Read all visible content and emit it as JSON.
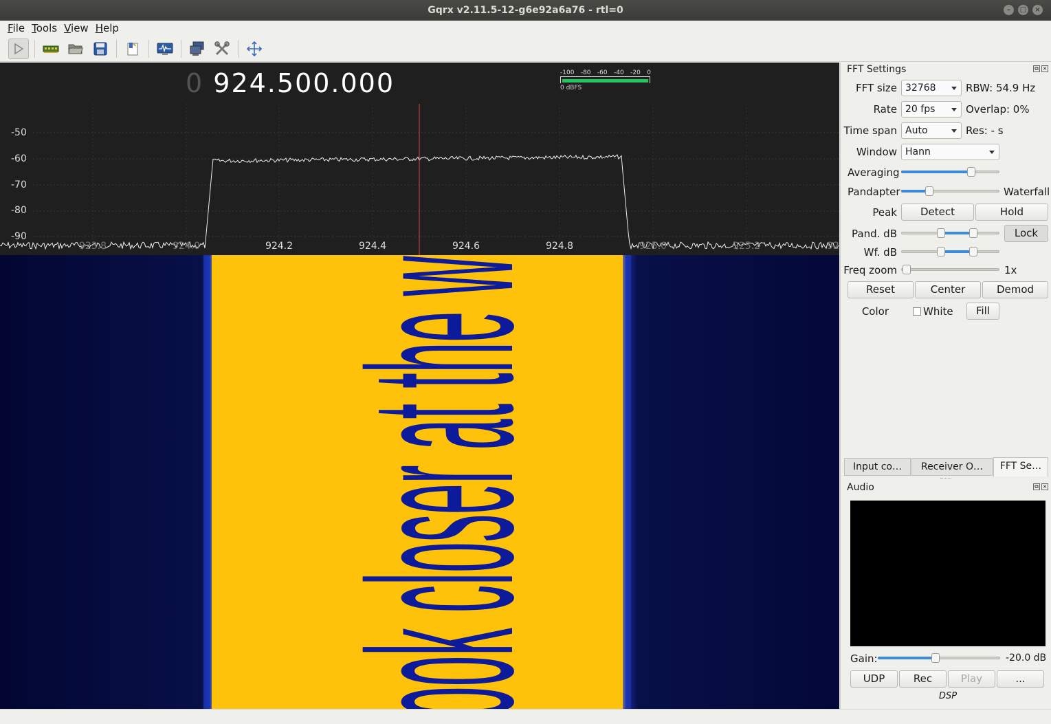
{
  "window": {
    "title": "Gqrx v2.11.5-12-g6e92a6a76 - rtl=0"
  },
  "menu": [
    {
      "underline": "F",
      "rest": "ile"
    },
    {
      "underline": "T",
      "rest": "ools"
    },
    {
      "underline": "V",
      "rest": "iew"
    },
    {
      "underline": "H",
      "rest": "elp"
    }
  ],
  "toolbar": {
    "icons": [
      "play-icon",
      "device-icon",
      "open-icon",
      "save-icon",
      "remote-icon",
      "waterfall-icon",
      "io-devices-icon",
      "config-icon",
      "fullscreen-icon"
    ]
  },
  "freq": {
    "prefix": "0",
    "value": "924.500.000"
  },
  "meter": {
    "ticks": [
      "-100",
      "-80",
      "-60",
      "-40",
      "-20",
      "0"
    ],
    "label": "0 dBFS",
    "color": "#22c55e"
  },
  "plot": {
    "y_labels": [
      "-50",
      "-60",
      "-70",
      "-80",
      "-90"
    ],
    "x_labels": [
      "923.8",
      "924.0",
      "924.2",
      "924.4",
      "924.6",
      "924.8",
      "925.0",
      "925.2",
      "92"
    ],
    "center_marker_color": "#e04545",
    "waterfall_text": "look closer at the waterfall"
  },
  "fft_settings": {
    "title": "FFT Settings",
    "fft_size_label": "FFT size",
    "fft_size": "32768",
    "rbw": "RBW: 54.9 Hz",
    "rate_label": "Rate",
    "rate": "20 fps",
    "overlap": "Overlap: 0%",
    "timespan_label": "Time span",
    "timespan": "Auto",
    "res": "Res: - s",
    "window_label": "Window",
    "window": "Hann",
    "averaging_label": "Averaging",
    "averaging_level": 0.73,
    "pandapter_label": "Pandapter",
    "waterfall_label": "Waterfall",
    "pandapter_split": 0.27,
    "peak_label": "Peak",
    "detect_label": "Detect",
    "hold_label": "Hold",
    "pand_db_label": "Pand. dB",
    "lock_label": "Lock",
    "wf_db_label": "Wf. dB",
    "freq_zoom_label": "Freq zoom",
    "freq_zoom_value": "1x",
    "reset_label": "Reset",
    "center_label": "Center",
    "demod_label": "Demod",
    "color_label": "Color",
    "white_label": "White",
    "fill_label": "Fill"
  },
  "tabs": [
    {
      "label": "Input co…",
      "active": false
    },
    {
      "label": "Receiver O…",
      "active": false
    },
    {
      "label": "FFT Se…",
      "active": true
    }
  ],
  "audio": {
    "title": "Audio",
    "gain_label": "Gain:",
    "gain_value": "-20.0 dB",
    "gain_level": 0.47,
    "udp_label": "UDP",
    "rec_label": "Rec",
    "play_label": "Play",
    "more_label": "...",
    "dsp_label": "DSP"
  }
}
